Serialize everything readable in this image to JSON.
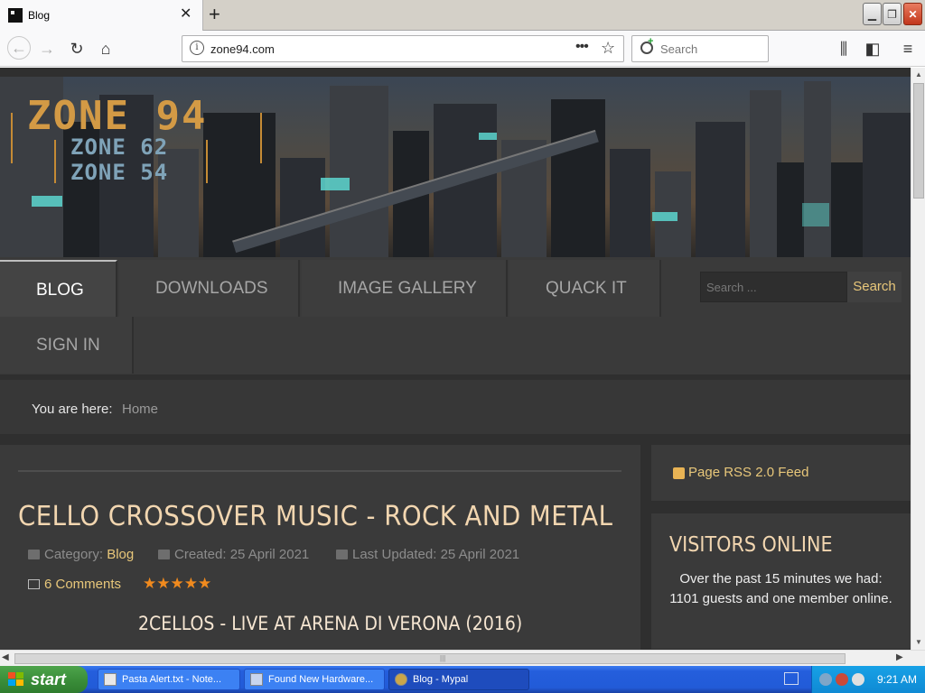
{
  "browser": {
    "tab_title": "Blog",
    "url": "zone94.com",
    "search_placeholder": "Search"
  },
  "site": {
    "logo_main": "ZONE 94",
    "logo_sub1": "ZONE 62",
    "logo_sub2": "ZONE 54",
    "menu": [
      "BLOG",
      "DOWNLOADS",
      "IMAGE GALLERY",
      "QUACK IT",
      "SIGN IN"
    ],
    "search_placeholder": "Search ...",
    "search_button": "Search",
    "breadcrumb_label": "You are here:",
    "breadcrumb_home": "Home"
  },
  "article": {
    "title": "CELLO CROSSOVER MUSIC - ROCK AND METAL",
    "category_label": "Category:",
    "category": "Blog",
    "created": "Created: 25 April 2021",
    "updated": "Last Updated: 25 April 2021",
    "comments": "6 Comments",
    "rating": 5,
    "stars": "★★★★★",
    "video_title": "2CELLOS - LIVE AT ARENA DI VERONA (2016)"
  },
  "sidebar": {
    "rss": "Page RSS 2.0 Feed",
    "visitors_title": "VISITORS ONLINE",
    "visitors_text": "Over the past 15 minutes we had: 1101 guests and one member online."
  },
  "taskbar": {
    "start": "start",
    "items": [
      "Pasta Alert.txt - Note...",
      "Found New Hardware...",
      "Blog - Mypal"
    ],
    "clock": "9:21 AM"
  },
  "colors": {
    "accent": "#e8c77a",
    "title": "#f2d6b0",
    "stars": "#f08a1e",
    "page_bg": "#2f2f2f"
  },
  "icons": [
    "back-icon",
    "forward-icon",
    "reload-icon",
    "home-icon",
    "info-icon",
    "more-icon",
    "bookmark-star-icon",
    "search-icon",
    "library-icon",
    "sidebar-icon",
    "menu-icon",
    "folder-icon",
    "calendar-icon",
    "comment-icon",
    "rss-icon",
    "windows-flag-icon",
    "notepad-icon",
    "hardware-icon",
    "browser-icon"
  ]
}
